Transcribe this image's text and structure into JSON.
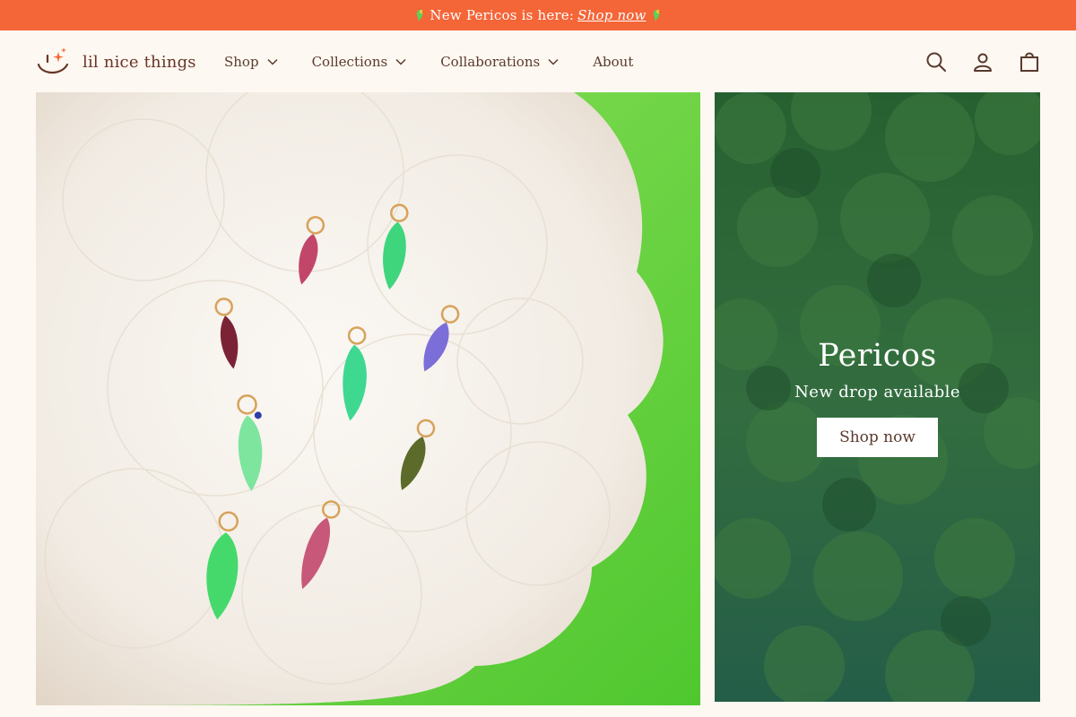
{
  "announcement": {
    "text": "New Pericos is here:",
    "link_label": "Shop now",
    "left_icon": "parrot-icon",
    "right_icon": "parrot-icon"
  },
  "brand": {
    "name": "lil nice things",
    "logo_icon": "smiley-sparkle-icon"
  },
  "nav": {
    "items": [
      {
        "label": "Shop",
        "has_dropdown": true
      },
      {
        "label": "Collections",
        "has_dropdown": true
      },
      {
        "label": "Collaborations",
        "has_dropdown": true
      },
      {
        "label": "About",
        "has_dropdown": false
      }
    ]
  },
  "header_icons": [
    "search-icon",
    "account-icon",
    "cart-icon"
  ],
  "hero_right": {
    "title": "Pericos",
    "subtitle": "New drop available",
    "cta_label": "Shop now"
  },
  "colors": {
    "announcement_bg": "#f46537",
    "page_bg": "#fdf8f1",
    "text": "#5a3a2e",
    "hero_left_bg": "#6ed448",
    "hero_right_bg": "#2f6e3c"
  }
}
